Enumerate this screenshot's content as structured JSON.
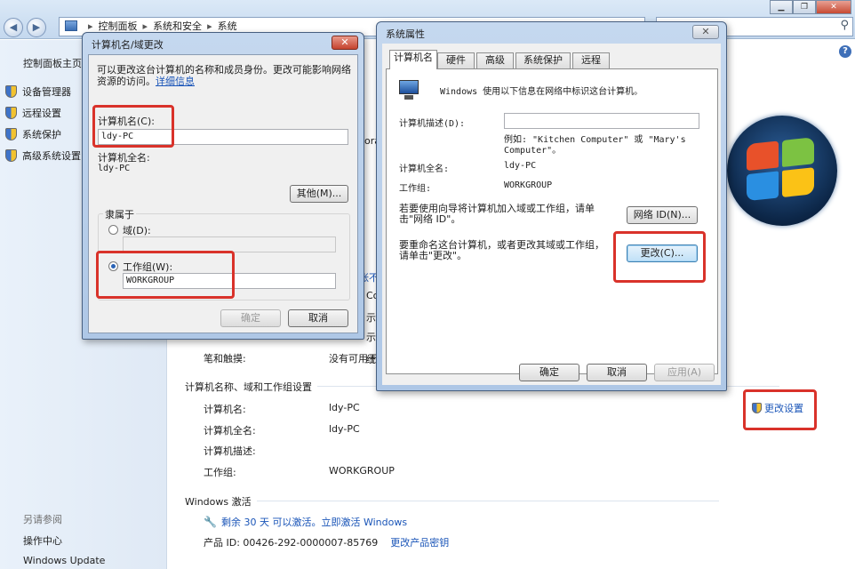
{
  "explorer": {
    "breadcrumb": [
      "控制面板",
      "系统和安全",
      "系统"
    ],
    "sidebar": {
      "home": "控制面板主页",
      "items": [
        "设备管理器",
        "远程设置",
        "系统保护",
        "高级系统设置"
      ],
      "see_also": "另请参阅",
      "links": [
        "操作中心",
        "Windows Update"
      ]
    },
    "peek": [
      "ora",
      "Co",
      "示",
      "示",
      "统",
      "帐不"
    ],
    "pen_touch_label": "笔和触摸:",
    "pen_touch_value": "没有可用于",
    "section_title": "计算机名称、域和工作组设置",
    "rows": [
      {
        "label": "计算机名:",
        "value": "ldy-PC"
      },
      {
        "label": "计算机全名:",
        "value": "ldy-PC"
      },
      {
        "label": "计算机描述:",
        "value": ""
      },
      {
        "label": "工作组:",
        "value": "WORKGROUP"
      }
    ],
    "change_settings": "更改设置",
    "activation_title": "Windows 激活",
    "activation_text": "剩余 30 天 可以激活。立即激活 Windows",
    "product_id": "产品 ID: 00426-292-0000007-85769",
    "change_key": "更改产品密钥"
  },
  "name_dialog": {
    "title": "计算机名/域更改",
    "close": "✕",
    "description": "可以更改这台计算机的名称和成员身份。更改可能影响网络资源的访问。",
    "info_link": "详细信息",
    "computer_name_label": "计算机名(C):",
    "computer_name_value": "ldy-PC",
    "full_name_label": "计算机全名:",
    "full_name_value": "ldy-PC",
    "more_button": "其他(M)...",
    "member_of": "隶属于",
    "domain_label": "域(D):",
    "domain_value": "",
    "workgroup_label": "工作组(W):",
    "workgroup_value": "WORKGROUP",
    "ok": "确定",
    "cancel": "取消"
  },
  "props_dialog": {
    "title": "系统属性",
    "close": "✕",
    "tabs": [
      "计算机名",
      "硬件",
      "高级",
      "系统保护",
      "远程"
    ],
    "intro": "Windows 使用以下信息在网络中标识这台计算机。",
    "desc_label": "计算机描述(D):",
    "desc_value": "",
    "example": "例如: \"Kitchen Computer\" 或 \"Mary's Computer\"。",
    "full_name_label": "计算机全名:",
    "full_name_value": "ldy-PC",
    "workgroup_label": "工作组:",
    "workgroup_value": "WORKGROUP",
    "network_text": "若要使用向导将计算机加入域或工作组，请单击\"网络 ID\"。",
    "network_button": "网络 ID(N)...",
    "rename_text": "要重命名这台计算机，或者更改其域或工作组，请单击\"更改\"。",
    "change_button": "更改(C)...",
    "ok": "确定",
    "cancel": "取消",
    "apply": "应用(A)"
  }
}
